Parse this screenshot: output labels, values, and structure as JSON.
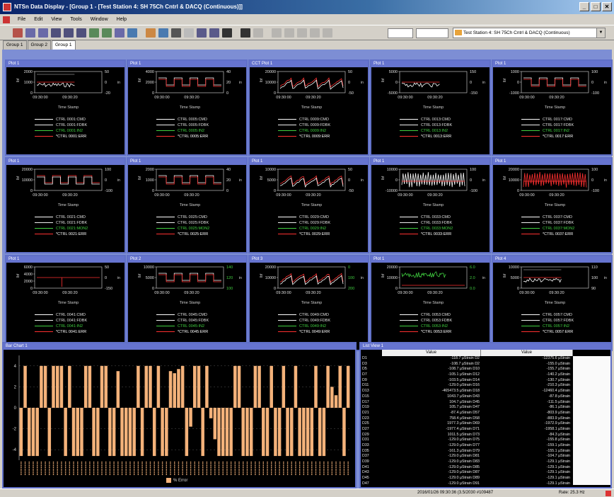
{
  "window": {
    "title": "NTSn Data Display - [Group 1 - [Test Station 4: SH 75Ch Cntrl & DACQ (Continuous)]]",
    "minimize": "_",
    "maximize": "□",
    "close": "✕"
  },
  "menu": [
    "File",
    "Edit",
    "View",
    "Tools",
    "Window",
    "Help"
  ],
  "toolbar": {
    "station_combo": "Test Station 4: SH 75Ch Cntrl & DACQ (Continuous)",
    "combo_arrow": "▼"
  },
  "tabs": [
    {
      "label": "Group 1",
      "active": false
    },
    {
      "label": "Group 2",
      "active": false
    },
    {
      "label": "Group 1",
      "active": true
    }
  ],
  "colors": {
    "panel_border": "#6070c8",
    "title_blue": "#6674cf",
    "trace_white": "#ffffff",
    "trace_red": "#ff3030",
    "trace_green": "#40d040",
    "bar_fill": "#f4b27a"
  },
  "plots": [
    {
      "title": "Plot 1",
      "yticks": [
        "2000",
        "1000",
        "0"
      ],
      "y2ticks": [
        "50",
        "0",
        "-20"
      ],
      "ylabel": "lbf",
      "y2label": "in",
      "xticks": [
        "09:30:00",
        "09:30:20"
      ],
      "xlabel": "Time Stamp",
      "style": "box",
      "legend": [
        "CTRL 0001:CMD",
        "CTRL 0001:FDBK",
        "CTRL 0001:IN2",
        "*CTRL 0001:ERR"
      ]
    },
    {
      "title": "Plot 1",
      "yticks": [
        "4000",
        "2000",
        "0"
      ],
      "y2ticks": [
        "40",
        "20",
        "0"
      ],
      "ylabel": "lbf",
      "y2label": "in",
      "xticks": [
        "09:30:00",
        "09:30:20"
      ],
      "xlabel": "Time Stamp",
      "style": "steps",
      "legend": [
        "CTRL 0005:CMD",
        "CTRL 0005:FDBK",
        "CTRL 0005:IN2",
        "*CTRL 0005:ERR"
      ]
    },
    {
      "title": "CCT Plot 1",
      "yticks": [
        "20000",
        "10000",
        "0"
      ],
      "y2ticks": [
        "50",
        "0",
        "-50"
      ],
      "ylabel": "lbf",
      "y2label": "in",
      "xticks": [
        "09:30:00",
        "09:30:20"
      ],
      "xlabel": "Time Stamp",
      "style": "burst",
      "legend": [
        "CTRL 0009:CMD",
        "CTRL 0009:FDBK",
        "CTRL 0009:IN2",
        "*CTRL 0009:ERR"
      ]
    },
    {
      "title": "Plot 1",
      "yticks": [
        "5000",
        "0",
        "-5000"
      ],
      "y2ticks": [
        "150",
        "0",
        "-150"
      ],
      "ylabel": "lbf",
      "y2label": "in",
      "xticks": [
        "09:30:00",
        "09:30:20"
      ],
      "xlabel": "Time Stamp",
      "style": "flatred",
      "legend": [
        "CTRL 0013:CMD",
        "CTRL 0013:FDBK",
        "CTRL 0013:IN2",
        "*CTRL 0013:ERR"
      ]
    },
    {
      "title": "Plot 1",
      "yticks": [
        "1000",
        "0",
        "-1000"
      ],
      "y2ticks": [
        "100",
        "0",
        "-100"
      ],
      "ylabel": "lbf",
      "y2label": "in",
      "xticks": [
        "09:30:00",
        "09:30:20"
      ],
      "xlabel": "Time Stamp",
      "style": "square",
      "legend": [
        "CTRL 0017:CMD",
        "CTRL 0017:FDBK",
        "CTRL 0017:IN2",
        "*CTRL 0017:ERR"
      ]
    },
    {
      "title": "Plot 1",
      "yticks": [
        "20000",
        "10000",
        "0"
      ],
      "y2ticks": [
        "100",
        "0",
        "-100"
      ],
      "ylabel": "lbf",
      "y2label": "in",
      "xticks": [
        "09:30:00",
        "09:30:20"
      ],
      "xlabel": "Time Stamp",
      "style": "squarered",
      "legend": [
        "CTRL 0021:CMD",
        "CTRL 0021:FDBK",
        "CTRL 0021:MON2",
        "*CTRL 0021:ERR"
      ]
    },
    {
      "title": "Plot 1",
      "yticks": [
        "2000",
        "1000",
        "0"
      ],
      "y2ticks": [
        "40",
        "20",
        "0"
      ],
      "ylabel": "lbf",
      "y2label": "in",
      "xticks": [
        "09:30:00",
        "09:30:20"
      ],
      "xlabel": "Time Stamp",
      "style": "square",
      "legend": [
        "CTRL 0025:CMD",
        "CTRL 0025:FDBK",
        "CTRL 0025:MON2",
        "*CTRL 0025:ERR"
      ]
    },
    {
      "title": "Plot 1",
      "yticks": [
        "10000",
        "5000",
        "0"
      ],
      "y2ticks": [
        "50",
        "0",
        "-50"
      ],
      "ylabel": "lbf",
      "y2label": "in",
      "xticks": [
        "09:30:00",
        "09:30:20"
      ],
      "xlabel": "Time Stamp",
      "style": "saw",
      "legend": [
        "CTRL 0029:CMD",
        "CTRL 0029:FDBK",
        "CTRL 0029:IN2",
        "*CTRL 0029:ERR"
      ]
    },
    {
      "title": "Plot 1",
      "yticks": [
        "10000",
        "0",
        "-10000"
      ],
      "y2ticks": [
        "100",
        "0",
        "-100"
      ],
      "ylabel": "lbf",
      "y2label": "in",
      "xticks": [
        "09:30:00",
        "09:30:20"
      ],
      "xlabel": "Time Stamp",
      "style": "spike",
      "legend": [
        "CTRL 0033:CMD",
        "CTRL 0033:FDBK",
        "CTRL 0033:MON2",
        "*CTRL 0033:ERR"
      ]
    },
    {
      "title": "Plot 1",
      "yticks": [
        "20000",
        "10000",
        "0"
      ],
      "y2ticks": [
        "100",
        "0",
        "-100"
      ],
      "ylabel": "lbf",
      "y2label": "in",
      "xticks": [
        "09:30:00",
        "09:30:20"
      ],
      "xlabel": "Time Stamp",
      "style": "dense",
      "legend": [
        "CTRL 0037:CMD",
        "CTRL 0037:FDBK",
        "CTRL 0037:MON2",
        "*CTRL 0037:ERR"
      ]
    },
    {
      "title": "Plot 1",
      "yticks": [
        "6000",
        "4000",
        "2000",
        "0"
      ],
      "y2ticks": [
        "50",
        "0",
        "-150"
      ],
      "ylabel": "lbf",
      "y2label": "in",
      "xticks": [
        "09:30:00",
        "09:30:20"
      ],
      "xlabel": "Time Stamp",
      "style": "drop",
      "legend": [
        "CTRL 0041:CMD",
        "CTRL 0041:FDBK",
        "CTRL 0041:IN2",
        "*CTRL 0041:ERR"
      ]
    },
    {
      "title": "Plot 2",
      "yticks": [
        "10000",
        "5000",
        "0"
      ],
      "y2ticks": [
        "140",
        "120",
        "100"
      ],
      "ylabel": "lbf",
      "y2label": "in",
      "xticks": [
        "09:30:00",
        "09:30:20"
      ],
      "xlabel": "Time Stamp",
      "style": "steps",
      "legend": [
        "CTRL 0045:CMD",
        "CTRL 0045:FDBK",
        "CTRL 0045:IN2",
        "*CTRL 0045:ERR"
      ]
    },
    {
      "title": "Plot 3",
      "yticks": [
        "20000",
        "10000",
        "0"
      ],
      "y2ticks": [
        "0",
        "100",
        "200"
      ],
      "ylabel": "lbf",
      "y2label": "in",
      "xticks": [
        "09:30:00",
        "09:30:20"
      ],
      "xlabel": "Time Stamp",
      "style": "burst",
      "legend": [
        "CTRL 0049:CMD",
        "CTRL 0049:FDBK",
        "CTRL 0049:IN2",
        "*CTRL 0049:ERR"
      ]
    },
    {
      "title": "Plot 1",
      "yticks": [
        "20000",
        "10000",
        "0"
      ],
      "y2ticks": [
        "6.0",
        "2.0",
        "0.0"
      ],
      "ylabel": "lbf",
      "y2label": "in",
      "xticks": [
        "09:30:00",
        "09:30:20"
      ],
      "xlabel": "Time Stamp",
      "style": "green",
      "legend": [
        "CTRL 0053:CMD",
        "CTRL 0053:FDBK",
        "CTRL 0053:IN2",
        "*CTRL 0053:ERR"
      ]
    },
    {
      "title": "Plot 4",
      "yticks": [
        "10000",
        "5000",
        "0"
      ],
      "y2ticks": [
        "110",
        "100",
        "90"
      ],
      "ylabel": "lbf",
      "y2label": "in",
      "xticks": [
        "09:30:00",
        "09:30:20"
      ],
      "xlabel": "Time Stamp",
      "style": "box",
      "legend": [
        "CTRL 0057:CMD",
        "CTRL 0057:FDBK",
        "CTRL 0057:IN2",
        "*CTRL 0057:ERR"
      ]
    }
  ],
  "bar_chart": {
    "title": "Bar Chart 1",
    "chart_data": {
      "type": "bar",
      "yticks": [
        "4",
        "2",
        "0",
        "-2",
        "-4"
      ],
      "ylim": [
        -5,
        5
      ],
      "values": [
        -4.6,
        4,
        -4.6,
        -4.6,
        -4.6,
        4,
        4,
        -4.6,
        4,
        4,
        4,
        -4.6,
        4,
        -4.6,
        -4.6,
        -4.6,
        4,
        4,
        -4.6,
        -4.6,
        4,
        4,
        -4.6,
        -4.6,
        3.5,
        -4.6,
        -4.6,
        -4.6,
        -4.6,
        4,
        -4.6,
        4,
        4,
        -4.6,
        4,
        -4.6,
        -4.6,
        3.5,
        3.3,
        3.7,
        4,
        -4.6,
        -1.8,
        4,
        4,
        -4.6,
        4,
        -1,
        -3,
        -4.6,
        -4.6,
        -4.6,
        -4.6,
        4,
        4,
        -4.6,
        -4.6,
        -4.6,
        4,
        4,
        -4.6,
        -4.6,
        4,
        -4.6,
        -4.6,
        4,
        -4.6,
        -4.6,
        4,
        -4.6,
        -4.6,
        -4.6,
        -4.6,
        4,
        -4.6,
        -4.6,
        4,
        2,
        1.2,
        4,
        -4.6,
        4
      ],
      "legend": [
        "% Error"
      ]
    }
  },
  "list_view": {
    "title": "List View 1",
    "headers": [
      "Value",
      "Value"
    ],
    "names1": [
      "D1",
      "D3",
      "D5",
      "D7",
      "D9",
      "D11",
      "D13",
      "D15",
      "D17",
      "D19",
      "D21",
      "D23",
      "D25",
      "D27",
      "D29",
      "D31",
      "D33",
      "D35",
      "D37",
      "D39",
      "D41",
      "D43",
      "D45",
      "D47"
    ],
    "values1": [
      "-118.7 µStrain D2",
      "-108.7 µStrain D2",
      "-108.7 µStrain D10",
      "-105.1 µStrain D12",
      "-103.5 µStrain D14",
      "-129.0 µStrain D16",
      "-465473.5 µStrain D18",
      "1043.7 µStrain D43",
      "104.7 µStrain D45",
      "105.7 µStrain D47",
      "-87.4 µStrain D57",
      "758.4 µStrain D58",
      "1977.3 µStrain D69",
      "-1977.4 µStrain D71",
      "1011.5 µStrain D73",
      "-129.0 µStrain D75",
      "-129.0 µStrain D77",
      "-161.3 µStrain D79",
      "-129.0 µStrain D81",
      "-129.0 µStrain D83",
      "-129.0 µStrain D85",
      "-129.0 µStrain D87",
      "-129.0 µStrain D89",
      "-129.0 µStrain D91"
    ],
    "values2": [
      "-12375.6 µStrain",
      "-155.0 µStrain",
      "-155.7 µStrain",
      "-140.2 µStrain",
      "-130.7 µStrain",
      "-210.3 µStrain",
      "-12460.4 µStrain",
      "-87.8 µStrain",
      "-111.5 µStrain",
      "-86.1 µStrain",
      "-803.9 µStrain",
      "-883.9 µStrain",
      "-1972.9 µStrain",
      "-1958.1 µStrain",
      "-84.3 µStrain",
      "-155.8 µStrain",
      "-159.1 µStrain",
      "-155.1 µStrain",
      "-104.7 µStrain",
      "-129.1 µStrain",
      "-129.1 µStrain",
      "-129.1 µStrain",
      "-129.1 µStrain",
      "-129.1 µStrain"
    ]
  },
  "status": {
    "timestamp": "2016/01/26 09:30:36 (3.5/2030 #109487",
    "rate": "Rate: 25.3 Hz"
  }
}
